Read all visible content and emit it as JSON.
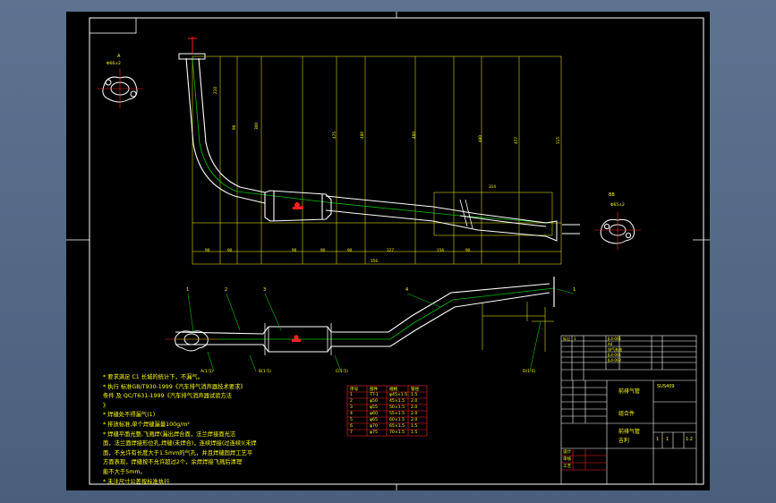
{
  "drawing": {
    "view_labels": {
      "a": "A",
      "flange_a_dim": "Φ66±2",
      "bb": "BB",
      "flange_b_dim": "Φ65±2"
    },
    "dimensions": {
      "vertical": [
        "210",
        "90",
        "300",
        "475",
        "480",
        "480",
        "480",
        "477",
        "515"
      ],
      "horizontal": [
        "90",
        "90",
        "90",
        "90",
        "90",
        "127",
        "156",
        "90",
        "356"
      ],
      "top_bracket": "314"
    },
    "lower_callouts": [
      "1",
      "2",
      "3",
      "4",
      "1"
    ],
    "section_marks": [
      "A(1:5)",
      "B(1:5)",
      "C(1:5)",
      "D(1:5)"
    ]
  },
  "notes": [
    "* 要求满足 C1 长城的统计下，不漏气。",
    "* 执行 标准GB/T930-1999《汽车排气消声器技术要求》",
    "条件 及 QC/T631-1999《汽车排气消声器试验方法",
    "》",
    "* 焊缝处不得漏气(1)",
    "* 排放标准,单个焊缝漏量100g/m²",
    "* 焊缝平面光整,飞溅焊(漏出焊合面，法兰焊接面光洁",
    "面，法兰面焊接形位孔,焊缝(未焊合)，连续焊接(过连续)(未焊",
    "面，不允许有长度大于1.5mm的气孔，并且焊缝固焊工艺平",
    "方面表现，焊缝按不允许超过2个，余焊焊接飞溅后清理",
    "能不大于5mm。",
    "* 未注尺寸公差按标准执行"
  ],
  "table": {
    "header": [
      "序号",
      "部件",
      "规格",
      "管径"
    ],
    "rows": [
      [
        "1",
        "TT-1",
        "φ45×1.5",
        "1.5"
      ],
      [
        "2",
        "φ50",
        "45×1.5",
        "2.0"
      ],
      [
        "3",
        "φ55",
        "50×1.5",
        "2.0"
      ],
      [
        "4",
        "φ60",
        "55×1.5",
        "2.0"
      ],
      [
        "5",
        "φ65",
        "60×1.5",
        "2.0"
      ],
      [
        "6",
        "φ70",
        "65×1.5",
        "1.5"
      ],
      [
        "7",
        "φ75",
        "70×1.5",
        "1.5"
      ]
    ]
  },
  "title_block": {
    "ref_rows": [
      [
        "标记",
        "1",
        "JL4-001"
      ],
      [
        "",
        "",
        "A4"
      ],
      [
        "",
        "",
        "排气系统"
      ],
      [
        "",
        "",
        "JL4-001"
      ],
      [
        "",
        "",
        "JL4-002"
      ],
      [
        "",
        "",
        ""
      ]
    ],
    "part_name": "前排气管",
    "assembly": "组合件",
    "material": "SUS409",
    "product": "前排气管",
    "company": "吉利",
    "scale_values": [
      "1",
      "1",
      "1:2"
    ],
    "sign_rows": [
      [
        "设计",
        "",
        ""
      ],
      [
        "审核",
        "",
        ""
      ],
      [
        "工艺",
        "",
        ""
      ]
    ]
  }
}
